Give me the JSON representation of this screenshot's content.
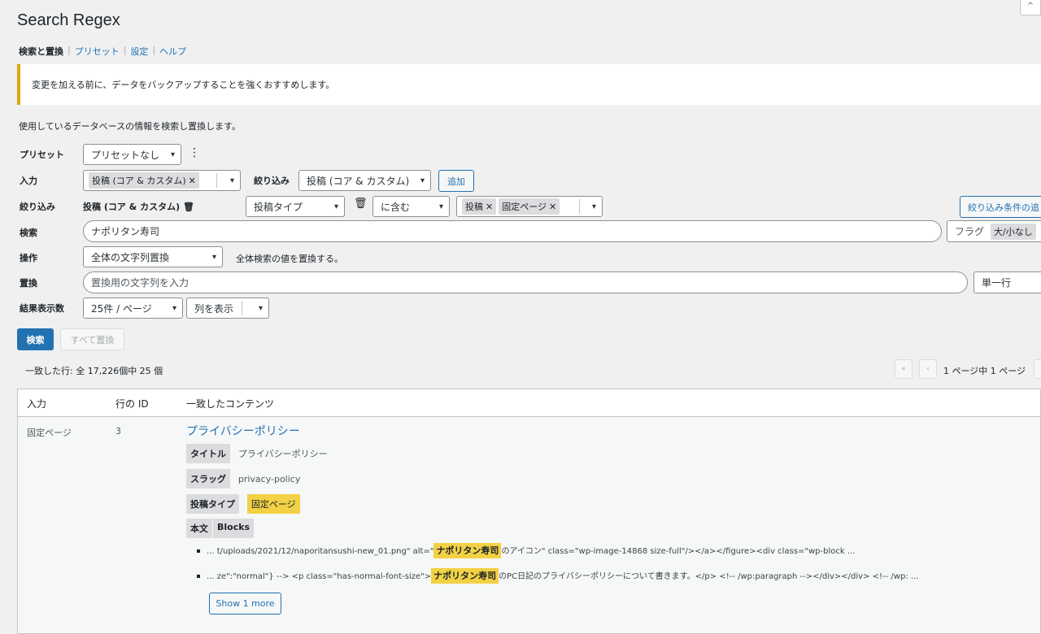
{
  "page_title": "Search Regex",
  "help_tab": "^",
  "subnav": {
    "search_replace": "検索と置換",
    "preset": "プリセット",
    "settings": "設定",
    "help": "ヘルプ",
    "sep": "|"
  },
  "notice": "変更を加える前に、データをバックアップすることを強くおすすめします。",
  "description": "使用しているデータベースの情報を検索し置換します。",
  "form": {
    "preset_label": "プリセット",
    "preset_value": "プリセットなし",
    "preset_more": "⋮",
    "source_label": "入力",
    "source_tag": "投稿 (コア & カスタム)",
    "filter_inline_label": "絞り込み",
    "filter_inline_value": "投稿 (コア & カスタム)",
    "add_button": "追加",
    "filter_label": "絞り込み",
    "filter_source": "投稿 (コア & カスタム)",
    "filter_field": "投稿タイプ",
    "filter_op": "に含む",
    "filter_tags": [
      "投稿",
      "固定ページ"
    ],
    "add_filter_button": "絞り込み条件の追",
    "search_label": "検索",
    "search_value": "ナポリタン寿司",
    "flags_label": "フラグ",
    "flags_tag": "大/小なし",
    "action_label": "操作",
    "action_value": "全体の文字列置換",
    "action_desc": "全体検索の値を置換する。",
    "replace_label": "置換",
    "replace_placeholder": "置換用の文字列を入力",
    "replace_mode": "単一行",
    "results_label": "結果表示数",
    "results_value": "25件 / ページ",
    "columns_value": "列を表示"
  },
  "buttons": {
    "search": "検索",
    "replace_all": "すべて置換"
  },
  "match_summary": "一致した行: 全 17,226個中 25 個",
  "pager": {
    "first": "«",
    "prev": "‹",
    "text": "1 ページ中 1 ページ"
  },
  "table": {
    "headers": [
      "入力",
      "行の ID",
      "一致したコンテンツ"
    ],
    "row": {
      "source": "固定ページ",
      "id": "3",
      "title": "プライバシーポリシー",
      "title_label": "タイトル",
      "title_value": "プライバシーポリシー",
      "slug_label": "スラッグ",
      "slug_value": "privacy-policy",
      "type_label": "投稿タイプ",
      "type_value": "固定ページ",
      "content_label": "本文",
      "blocks_label": "Blocks",
      "snippet1_pre": "... t/uploads/2021/12/naporitansushi-new_01.png\" alt=\"",
      "snippet1_match": "ナポリタン寿司",
      "snippet1_post": "のアイコン\" class=\"wp-image-14868 size-full\"/></a></figure><div class=\"wp-block ...",
      "snippet2_pre": "... ze\":\"normal\"} --> <p class=\"has-normal-font-size\">",
      "snippet2_match": "ナポリタン寿司",
      "snippet2_post": "のPC日記のプライバシーポリシーについて書きます。</p> <!-- /wp:paragraph --></div></div> <!-- /wp: ...",
      "show_more": "Show 1 more"
    }
  }
}
